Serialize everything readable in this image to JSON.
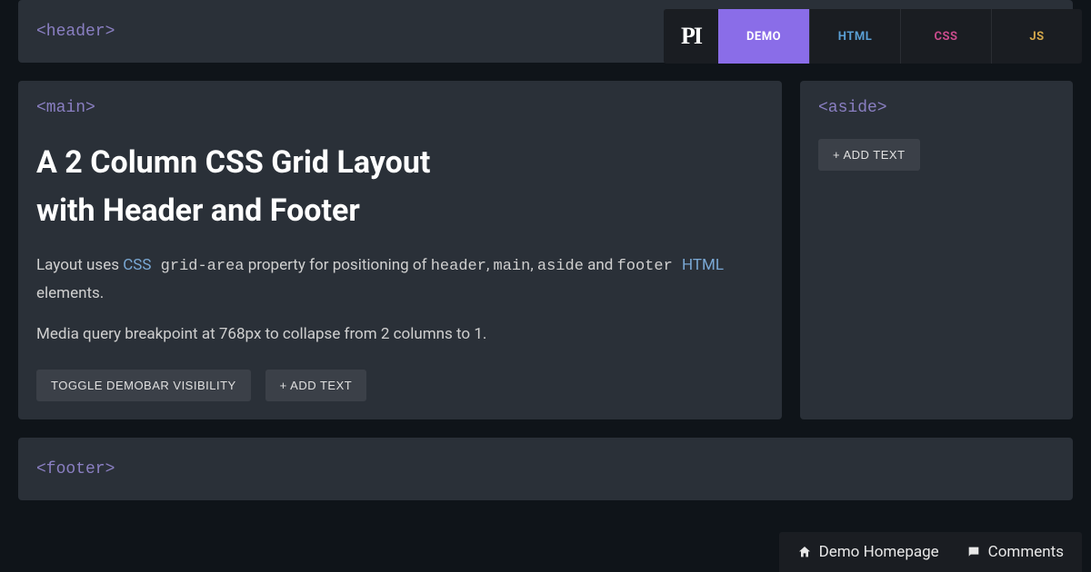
{
  "header": {
    "label": "<header>"
  },
  "main": {
    "label": "<main>",
    "title_line1": "A 2 Column CSS Grid Layout",
    "title_line2": "with Header and Footer",
    "desc_prefix": "Layout uses ",
    "desc_css": "CSS",
    "desc_gridarea": " grid-area",
    "desc_mid": " property for positioning of ",
    "desc_header": "header",
    "desc_c1": ", ",
    "desc_main": "main",
    "desc_c2": ", ",
    "desc_aside": "aside",
    "desc_and": " and ",
    "desc_footer": "footer ",
    "desc_html": "HTML",
    "desc_suffix": " elements.",
    "desc2": "Media query breakpoint at 768px to collapse from 2 columns to 1.",
    "toggle_label": "TOGGLE DEMOBAR VISIBILITY",
    "add_text_label": "+ ADD TEXT"
  },
  "aside": {
    "label": "<aside>",
    "add_text_label": "+ ADD TEXT"
  },
  "footer": {
    "label": "<footer>"
  },
  "demobar": {
    "logo": "PI",
    "tabs": {
      "demo": "DEMO",
      "html": "HTML",
      "css": "CSS",
      "js": "JS"
    }
  },
  "bottombar": {
    "homepage": "Demo Homepage",
    "comments": "Comments"
  }
}
